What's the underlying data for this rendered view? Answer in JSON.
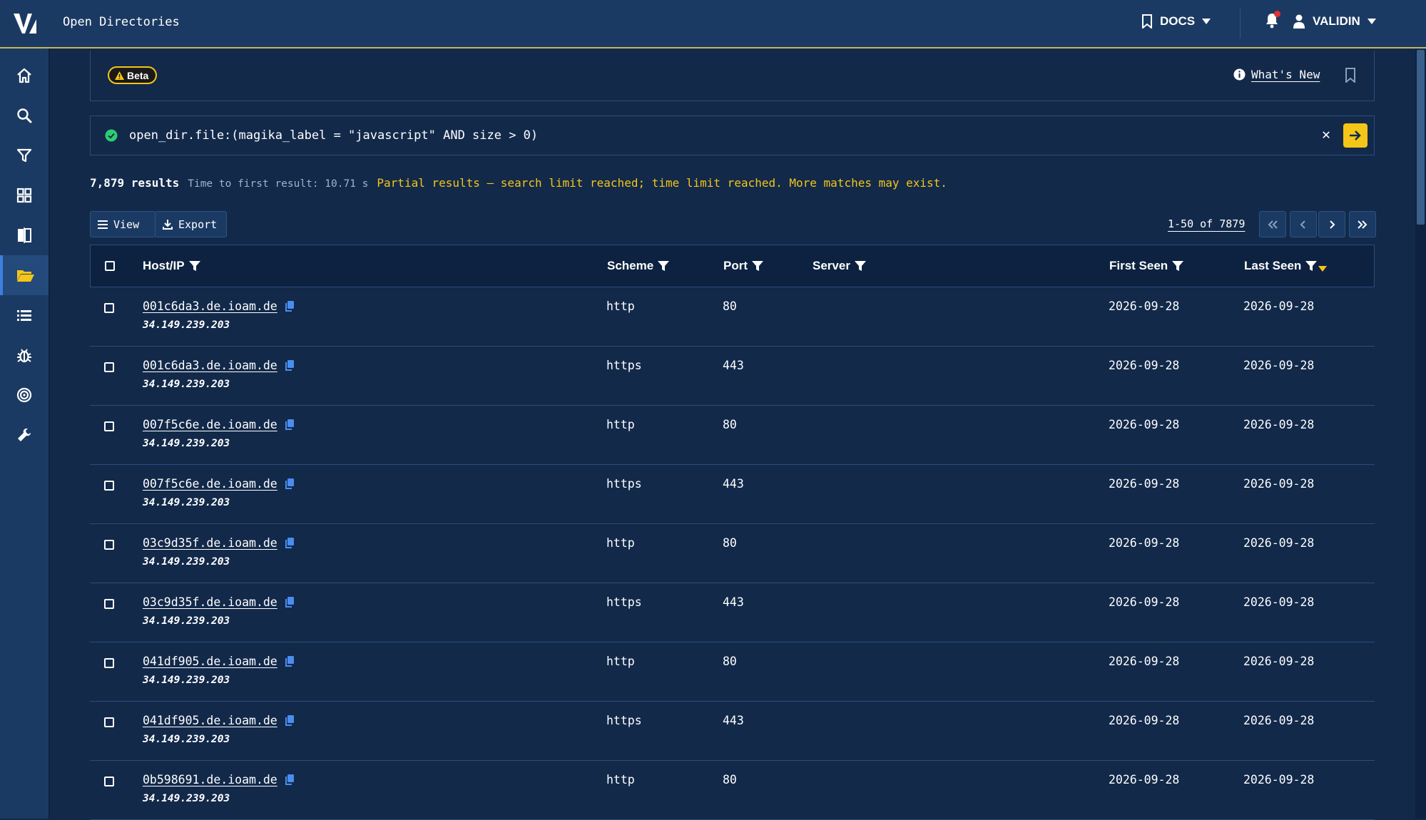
{
  "app": {
    "title": "Open Directories",
    "logo_text": "V",
    "docs_label": "DOCS",
    "user_label": "VALIDIN",
    "icons": {
      "logo": "validin-logo",
      "docs": "bookmark-icon",
      "notifications": "bell-icon",
      "user": "user-icon"
    }
  },
  "sidebar": {
    "items": [
      {
        "name": "home",
        "icon": "home-icon"
      },
      {
        "name": "search",
        "icon": "search-icon"
      },
      {
        "name": "filter",
        "icon": "filter-icon"
      },
      {
        "name": "dashboard",
        "icon": "grid-icon"
      },
      {
        "name": "compare",
        "icon": "compare-icon"
      },
      {
        "name": "open-directories",
        "icon": "folder-open-icon",
        "active": true
      },
      {
        "name": "lists",
        "icon": "list-icon"
      },
      {
        "name": "malware",
        "icon": "bug-icon"
      },
      {
        "name": "targets",
        "icon": "target-icon"
      },
      {
        "name": "tools",
        "icon": "wrench-icon"
      }
    ]
  },
  "beta": {
    "badge": "Beta",
    "whats_new": "What's New"
  },
  "query": {
    "text": "open_dir.file:(magika_label = \"javascript\" AND size > 0)",
    "clear": "✕"
  },
  "results": {
    "count": "7,879 results",
    "time": "Time to first result: 10.71 s",
    "warning": "Partial results — search limit reached; time limit reached. More matches may exist."
  },
  "toolbar": {
    "view_label": "View",
    "export_label": "Export",
    "range": "1-50 of 7879"
  },
  "table": {
    "columns": {
      "host": "Host/IP",
      "scheme": "Scheme",
      "port": "Port",
      "server": "Server",
      "first_seen": "First Seen",
      "last_seen": "Last Seen"
    },
    "sort": {
      "column": "Last Seen",
      "direction": "descending"
    },
    "rows": [
      {
        "host": "001c6da3.de.ioam.de",
        "ip": "34.149.239.203",
        "scheme": "http",
        "port": "80",
        "server": "",
        "first_seen": "2026-09-28",
        "last_seen": "2026-09-28"
      },
      {
        "host": "001c6da3.de.ioam.de",
        "ip": "34.149.239.203",
        "scheme": "https",
        "port": "443",
        "server": "",
        "first_seen": "2026-09-28",
        "last_seen": "2026-09-28"
      },
      {
        "host": "007f5c6e.de.ioam.de",
        "ip": "34.149.239.203",
        "scheme": "http",
        "port": "80",
        "server": "",
        "first_seen": "2026-09-28",
        "last_seen": "2026-09-28"
      },
      {
        "host": "007f5c6e.de.ioam.de",
        "ip": "34.149.239.203",
        "scheme": "https",
        "port": "443",
        "server": "",
        "first_seen": "2026-09-28",
        "last_seen": "2026-09-28"
      },
      {
        "host": "03c9d35f.de.ioam.de",
        "ip": "34.149.239.203",
        "scheme": "http",
        "port": "80",
        "server": "",
        "first_seen": "2026-09-28",
        "last_seen": "2026-09-28"
      },
      {
        "host": "03c9d35f.de.ioam.de",
        "ip": "34.149.239.203",
        "scheme": "https",
        "port": "443",
        "server": "",
        "first_seen": "2026-09-28",
        "last_seen": "2026-09-28"
      },
      {
        "host": "041df905.de.ioam.de",
        "ip": "34.149.239.203",
        "scheme": "http",
        "port": "80",
        "server": "",
        "first_seen": "2026-09-28",
        "last_seen": "2026-09-28"
      },
      {
        "host": "041df905.de.ioam.de",
        "ip": "34.149.239.203",
        "scheme": "https",
        "port": "443",
        "server": "",
        "first_seen": "2026-09-28",
        "last_seen": "2026-09-28"
      },
      {
        "host": "0b598691.de.ioam.de",
        "ip": "34.149.239.203",
        "scheme": "http",
        "port": "80",
        "server": "",
        "first_seen": "2026-09-28",
        "last_seen": "2026-09-28"
      }
    ]
  },
  "colors": {
    "background": "#12294a",
    "topbar": "#1b3a63",
    "accent": "#f5c518",
    "border": "#2a4e7a",
    "success": "#2ecc71",
    "copy_icon": "#4a8df0"
  }
}
